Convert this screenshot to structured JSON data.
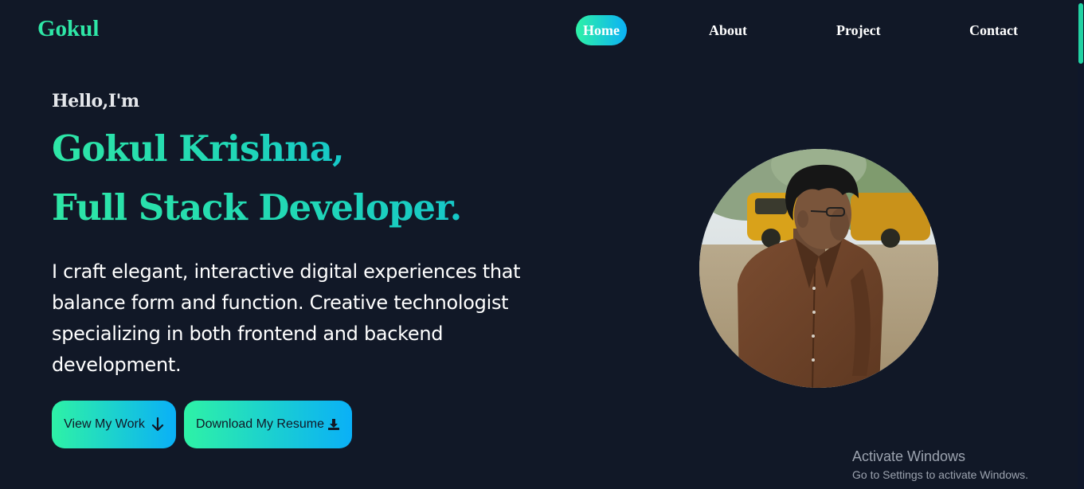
{
  "brand": {
    "logo": "Gokul"
  },
  "nav": {
    "items": [
      {
        "label": "Home",
        "active": true
      },
      {
        "label": "About",
        "active": false
      },
      {
        "label": "Project",
        "active": false
      },
      {
        "label": "Contact",
        "active": false
      }
    ]
  },
  "hero": {
    "greeting": "Hello,I'm",
    "name_line": "Gokul Krishna,",
    "role_line": "Full Stack Developer.",
    "description": "I craft elegant, interactive digital experiences that balance form and function. Creative technologist specializing in both frontend and backend development.",
    "buttons": {
      "work": {
        "label": "View My Work",
        "icon": "arrow-down-icon"
      },
      "resume": {
        "label": "Download My Resume",
        "icon": "download-icon"
      }
    },
    "avatar": {
      "alt": "profile-photo"
    }
  },
  "watermark": {
    "title": "Activate Windows",
    "subtitle": "Go to Settings to activate Windows."
  },
  "colors": {
    "background": "#111827",
    "accent_green": "#2ee6a6",
    "accent_blue": "#0bb1f6"
  }
}
